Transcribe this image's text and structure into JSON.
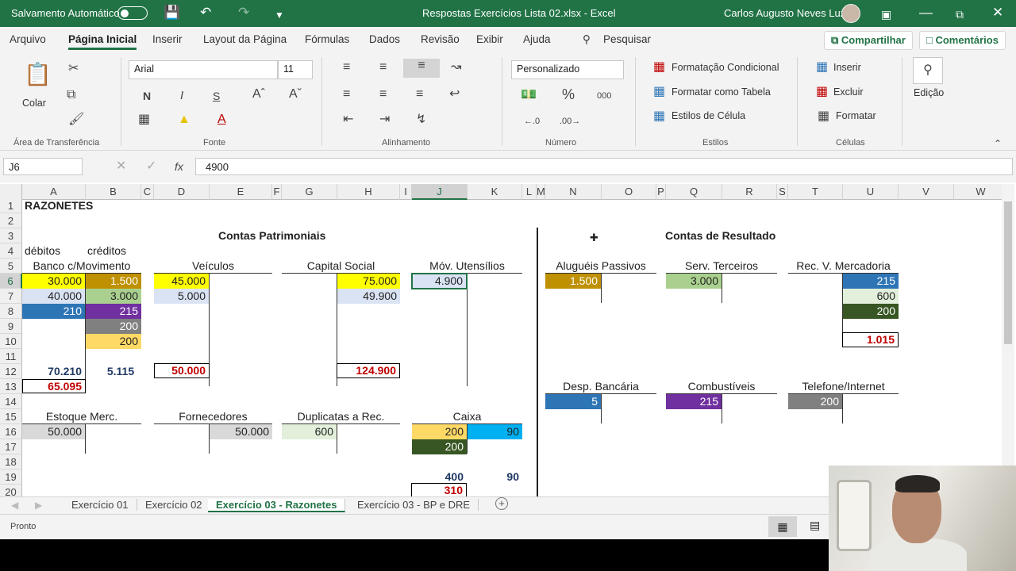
{
  "titlebar": {
    "autosave_label": "Salvamento Automático",
    "doc_title": "Respostas Exercícios Lista 02.xlsx  -  Excel",
    "user_name": "Carlos Augusto Neves Luz"
  },
  "menu": {
    "tabs": [
      "Arquivo",
      "Página Inicial",
      "Inserir",
      "Layout da Página",
      "Fórmulas",
      "Dados",
      "Revisão",
      "Exibir",
      "Ajuda"
    ],
    "search_label": "Pesquisar",
    "share_label": "Compartilhar",
    "comments_label": "Comentários"
  },
  "ribbon": {
    "paste_label": "Colar",
    "font_name": "Arial",
    "font_size": "11",
    "bold_label": "N",
    "italic_label": "I",
    "underline_label": "S",
    "number_format": "Personalizado",
    "cond_format_label": "Formatação Condicional",
    "format_table_label": "Formatar como Tabela",
    "cell_styles_label": "Estilos de Célula",
    "insert_label": "Inserir",
    "delete_label": "Excluir",
    "format_label": "Formatar",
    "edit_label": "Edição",
    "groups": [
      "Área de Transferência",
      "Fonte",
      "Alinhamento",
      "Número",
      "Estilos",
      "Células"
    ]
  },
  "formula_bar": {
    "name_box": "J6",
    "value": "4900"
  },
  "columns": [
    "A",
    "B",
    "C",
    "D",
    "E",
    "F",
    "G",
    "H",
    "I",
    "J",
    "K",
    "L",
    "M",
    "N",
    "O",
    "P",
    "Q",
    "R",
    "S",
    "T",
    "U",
    "V",
    "W"
  ],
  "rows": [
    "1",
    "2",
    "3",
    "4",
    "5",
    "6",
    "7",
    "8",
    "9",
    "10",
    "11",
    "12",
    "13",
    "14",
    "15",
    "16",
    "17",
    "18",
    "19",
    "20"
  ],
  "sheet": {
    "title": "RAZONETES",
    "patrimonial_header": "Contas Patrimoniais",
    "resultado_header": "Contas de Resultado",
    "debitos": "débitos",
    "creditos": "créditos",
    "accounts": {
      "banco": {
        "name": "Banco c/Movimento",
        "debits": [
          "30.000",
          "40.000",
          "210"
        ],
        "credits": [
          "1.500",
          "3.000",
          "215",
          "200",
          "200"
        ],
        "total_debit": "70.210",
        "total_credit": "5.115",
        "balance": "65.095"
      },
      "veiculos": {
        "name": "Veículos",
        "debits": [
          "45.000",
          "5.000"
        ],
        "total": "50.000"
      },
      "capital": {
        "name": "Capital Social",
        "credits": [
          "75.000",
          "49.900"
        ],
        "total": "124.900"
      },
      "utensilios": {
        "name": "Móv. Utensílios",
        "debits": [
          "4.900"
        ]
      },
      "alugueis": {
        "name": "Aluguéis Passivos",
        "debits": [
          "1.500"
        ]
      },
      "servicos": {
        "name": "Serv. Terceiros",
        "debits": [
          "3.000"
        ]
      },
      "receita": {
        "name": "Rec. V. Mercadoria",
        "credits": [
          "215",
          "600",
          "200"
        ],
        "total": "1.015"
      },
      "bancaria": {
        "name": "Desp. Bancária",
        "debits": [
          "5"
        ]
      },
      "combustiveis": {
        "name": "Combustíveis",
        "debits": [
          "215"
        ]
      },
      "telefone": {
        "name": "Telefone/Internet",
        "debits": [
          "200"
        ]
      },
      "estoque": {
        "name": "Estoque Merc.",
        "debits": [
          "50.000"
        ]
      },
      "fornecedores": {
        "name": "Fornecedores",
        "credits": [
          "50.000"
        ]
      },
      "duplicatas": {
        "name": "Duplicatas a Rec.",
        "debits": [
          "600"
        ]
      },
      "caixa": {
        "name": "Caixa",
        "debits": [
          "200",
          "200"
        ],
        "credits": [
          "90"
        ],
        "total_debit": "400",
        "total_credit": "90",
        "balance": "310"
      }
    }
  },
  "sheet_tabs": [
    "Exercício 01",
    "Exercício 02",
    "Exercício 03 - Razonetes",
    "Exercício 03 - BP e DRE"
  ],
  "status": {
    "ready": "Pronto"
  },
  "colors": {
    "excel_green": "#217346",
    "yellow": "#ffff00",
    "gold": "#bf9000",
    "light_blue": "#dae3f3",
    "blue": "#2e75b6",
    "green_light": "#a9d08e",
    "purple": "#7030a0",
    "gray": "#808080",
    "orange_light": "#ffd966",
    "dark_green": "#375623",
    "cyan": "#00b0f0",
    "pale_green": "#e2efda",
    "light_gray": "#d9d9d9"
  }
}
